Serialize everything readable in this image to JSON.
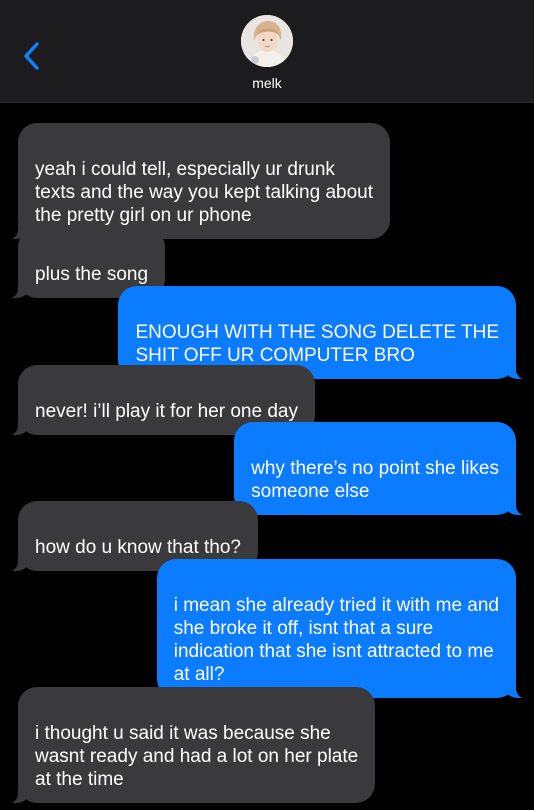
{
  "header": {
    "contact_name": "melk",
    "back_icon": "chevron-left-icon",
    "accent": "#0a84ff"
  },
  "messages": [
    {
      "from": "them",
      "text": "yeah i could tell, especially ur drunk\ntexts and the way you kept talking about\nthe pretty girl on ur phone"
    },
    {
      "from": "them",
      "text": "plus the song"
    },
    {
      "from": "me",
      "text": "ENOUGH WITH THE SONG DELETE THE\nSHIT OFF UR COMPUTER BRO"
    },
    {
      "from": "them",
      "text": "never! i’ll play it for her one day"
    },
    {
      "from": "me",
      "text": "why there’s no point she likes\nsomeone else"
    },
    {
      "from": "them",
      "text": "how do u know that tho?"
    },
    {
      "from": "me",
      "text": "i mean she already tried it with me and\nshe broke it off, isnt that a sure\nindication that she isnt attracted to me\nat all?"
    },
    {
      "from": "them",
      "text": "i thought u said it was because she\nwasnt ready and had a lot on her plate\nat the time"
    }
  ],
  "colors": {
    "background": "#000000",
    "header_bg": "#1c1c1e",
    "received_bubble": "#3a3a3c",
    "sent_bubble": "#0b7bff"
  }
}
